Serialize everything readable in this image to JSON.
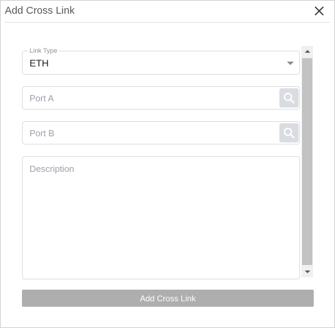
{
  "dialog": {
    "title": "Add Cross Link"
  },
  "form": {
    "link_type": {
      "label": "Link Type",
      "value": "ETH"
    },
    "port_a": {
      "placeholder": "Port A",
      "value": ""
    },
    "port_b": {
      "placeholder": "Port B",
      "value": ""
    },
    "description": {
      "placeholder": "Description",
      "value": ""
    },
    "submit_label": "Add Cross Link"
  },
  "icons": {
    "close": "close-icon",
    "search": "search-icon",
    "caret": "chevron-down-icon"
  },
  "colors": {
    "submit_background": "#aeaeae",
    "search_button_background": "#d9dce1",
    "placeholder_text": "#9aa0ab"
  }
}
